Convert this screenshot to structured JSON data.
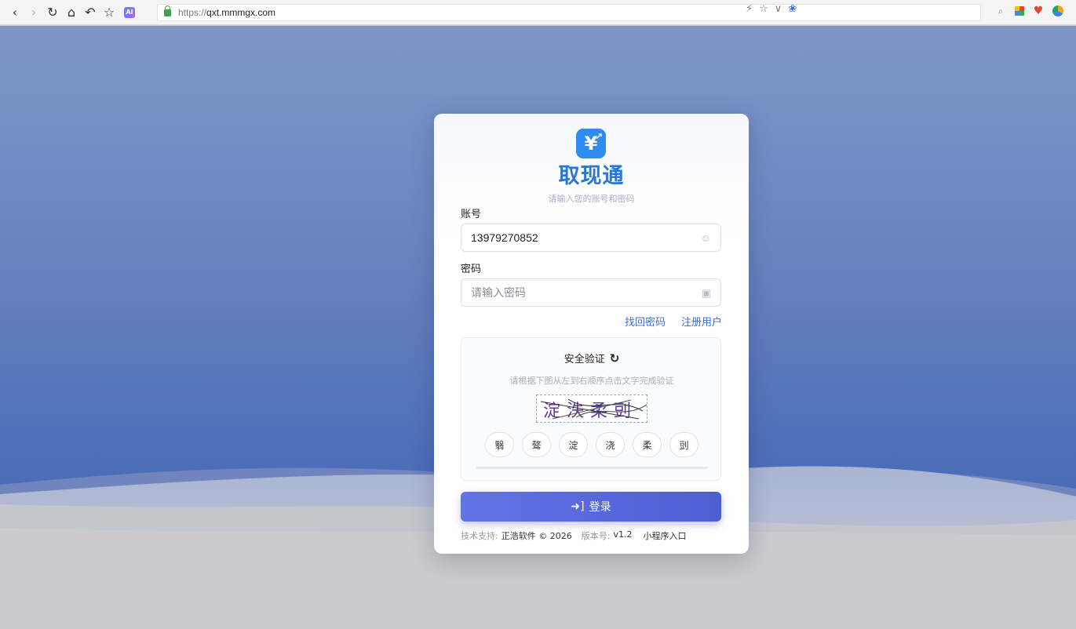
{
  "browser": {
    "url_scheme": "https://",
    "url_host": "qxt.mmmgx.com"
  },
  "app": {
    "title": "取现通",
    "subtitle": "请输入您的账号和密码",
    "brand_color": "#2876d8"
  },
  "form": {
    "account_label": "账号",
    "account_value": "13979270852",
    "password_label": "密码",
    "password_placeholder": "请输入密码",
    "forgot_password": "找回密码",
    "register": "注册用户"
  },
  "verify": {
    "title": "安全验证",
    "hint": "请根据下图从左到右顺序点击文字完成验证",
    "captcha_chars": [
      "淀",
      "泆",
      "柔",
      "剅"
    ],
    "chips": [
      "翳",
      "骜",
      "淀",
      "浇",
      "柔",
      "剅"
    ],
    "progress_fraction": 0
  },
  "login_button": "登录",
  "footer": {
    "support_label": "技术支持:",
    "support_company": "正浩软件 © 2026",
    "version_label": "版本号:",
    "version_value": "v1.2",
    "miniprogram": "小程序入口"
  }
}
